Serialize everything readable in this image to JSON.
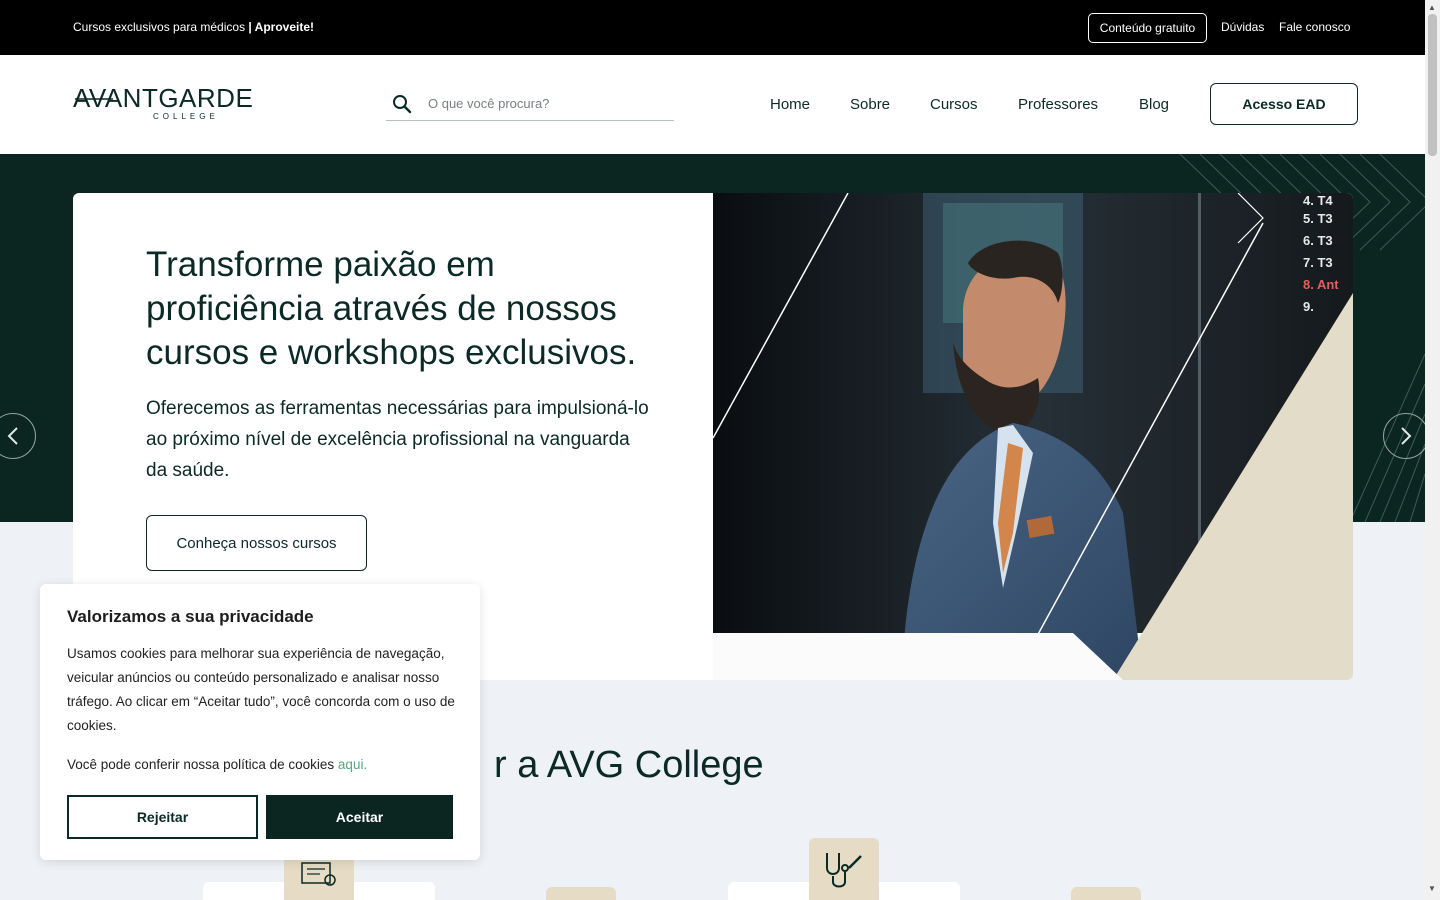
{
  "topbar": {
    "promo_text": "Cursos exclusivos para médicos ",
    "promo_bold": "| Aproveite!",
    "free_content": "Conteúdo gratuito",
    "faq": "Dúvidas",
    "contact": "Fale conosco"
  },
  "header": {
    "logo_word": "AVANTGARDE",
    "logo_sub": "COLLEGE",
    "search_placeholder": "O que você procura?",
    "nav": {
      "home": "Home",
      "about": "Sobre",
      "courses": "Cursos",
      "teachers": "Professores",
      "blog": "Blog"
    },
    "ead_button": "Acesso EAD"
  },
  "hero": {
    "title": "Transforme paixão em proficiência através de nossos cursos e workshops exclusivos.",
    "text": "Oferecemos as ferramentas necessárias para impulsioná-lo ao próximo nível de excelência profissional na vanguarda da saúde.",
    "button": "Conheça nossos cursos"
  },
  "section": {
    "title": "r a AVG College"
  },
  "cookie": {
    "title": "Valorizamos a sua privacidade",
    "text": "Usamos cookies para melhorar sua experiência de navegação, veicular anúncios ou conteúdo personalizado e analisar nosso tráfego. Ao clicar em “Aceitar tudo”, você concorda com o uso de cookies.",
    "policy_text": "Você pode conferir nossa política de cookies ",
    "policy_link": "aqui.",
    "reject": "Rejeitar",
    "accept": "Aceitar"
  },
  "colors": {
    "brand_dark": "#0b2521",
    "accent_beige": "#e6dcc6",
    "link_green": "#59a77d"
  }
}
